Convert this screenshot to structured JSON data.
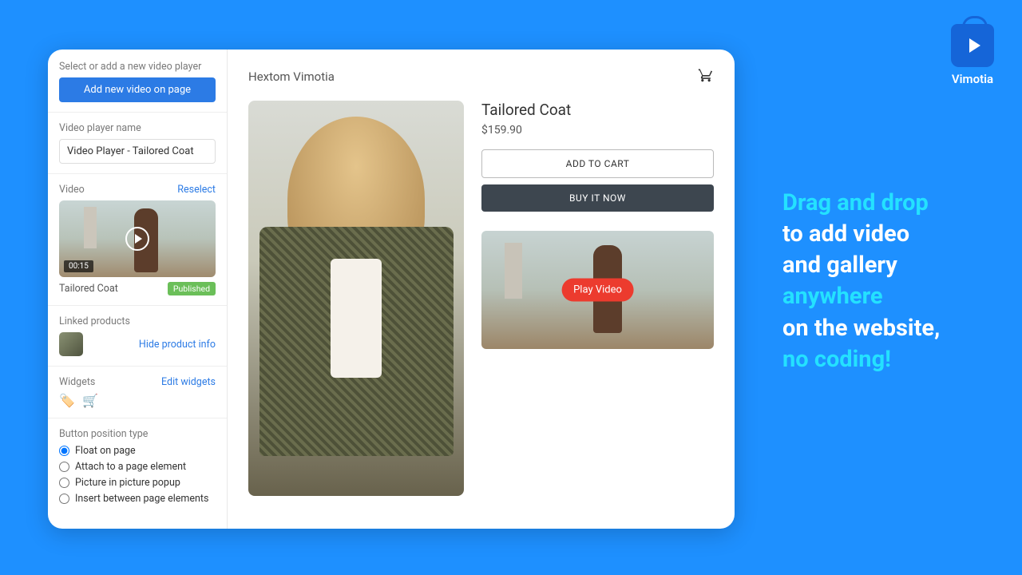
{
  "logo": {
    "name": "Vimotia"
  },
  "promo": {
    "line1": "Drag and drop",
    "line2": "to add video",
    "line3": "and gallery",
    "line4": "anywhere",
    "line5": "on the website,",
    "line6": "no coding!"
  },
  "sidebar": {
    "select_label": "Select or add a new video player",
    "add_button": "Add new video on page",
    "name_label": "Video player name",
    "name_value": "Video Player - Tailored Coat",
    "video_label": "Video",
    "reselect": "Reselect",
    "video_duration": "00:15",
    "video_title": "Tailored Coat",
    "published_badge": "Published",
    "linked_label": "Linked products",
    "hide_info": "Hide product info",
    "widgets_label": "Widgets",
    "edit_widgets": "Edit widgets",
    "position_label": "Button position type",
    "positions": [
      "Float on page",
      "Attach to a page element",
      "Picture in picture popup",
      "Insert between page elements"
    ]
  },
  "preview": {
    "brand": "Hextom Vimotia",
    "product_title": "Tailored Coat",
    "product_price": "$159.90",
    "add_to_cart": "ADD TO CART",
    "buy_now": "BUY IT NOW",
    "play_video": "Play Video"
  }
}
